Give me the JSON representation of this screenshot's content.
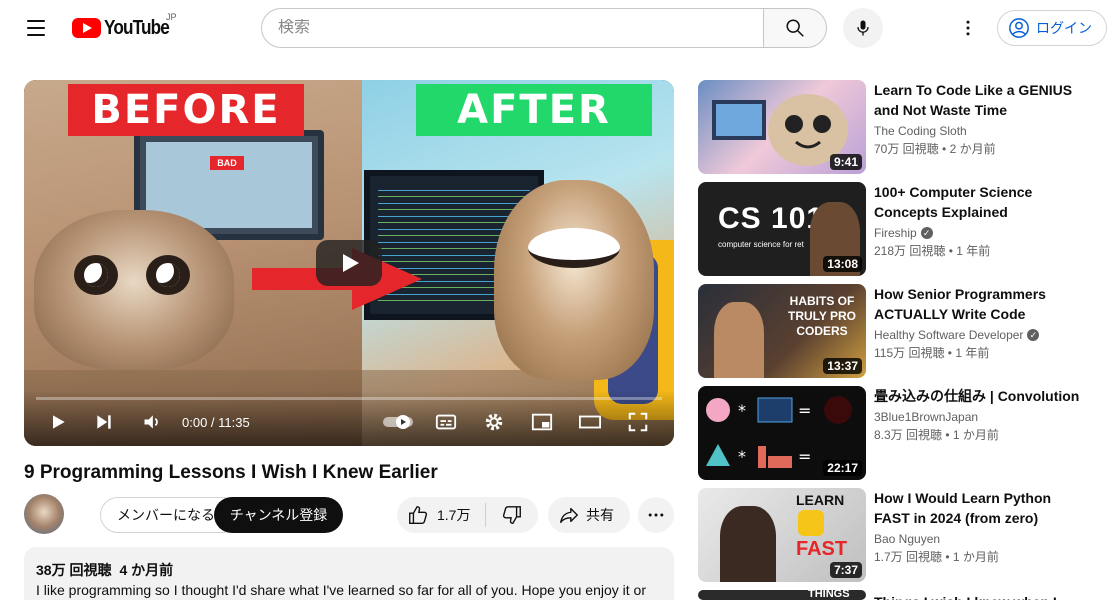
{
  "header": {
    "logo_text": "YouTube",
    "region": "JP",
    "search_placeholder": "検索",
    "signin_label": "ログイン"
  },
  "player": {
    "time_display": "0:00 / 11:35",
    "thumb_before_label": "BEFORE",
    "thumb_after_label": "AFTER",
    "thumb_bad_label": "BAD"
  },
  "video": {
    "title": "9 Programming Lessons I Wish I Knew Earlier",
    "member_label": "メンバーになる",
    "subscribe_label": "チャンネル登録",
    "like_count": "1.7万",
    "share_label": "共有",
    "views": "38万 回視聴",
    "age": "4 か月前",
    "description": "I like programming so I thought I'd share what I've learned so far for all of you. Hope you enjoy it or"
  },
  "recommendations": [
    {
      "title": "Learn To Code Like a GENIUS and Not Waste Time",
      "channel": "The Coding Sloth",
      "verified": false,
      "views": "70万 回視聴",
      "age": "2 か月前",
      "duration": "9:41"
    },
    {
      "title": "100+ Computer Science Concepts Explained",
      "channel": "Fireship",
      "verified": true,
      "views": "218万 回視聴",
      "age": "1 年前",
      "duration": "13:08",
      "thumb_text": "CS 101",
      "thumb_sub": "computer science for ret"
    },
    {
      "title": "How Senior Programmers ACTUALLY Write Code",
      "channel": "Healthy Software Developer",
      "verified": true,
      "views": "115万 回視聴",
      "age": "1 年前",
      "duration": "13:37",
      "thumb_text": "HABITS OF TRULY PRO CODERS"
    },
    {
      "title": "畳み込みの仕組み | Convolution",
      "channel": "3Blue1BrownJapan",
      "verified": false,
      "views": "8.3万 回視聴",
      "age": "1 か月前",
      "duration": "22:17"
    },
    {
      "title": "How I Would Learn Python FAST in 2024 (from zero)",
      "channel": "Bao Nguyen",
      "verified": false,
      "views": "1.7万 回視聴",
      "age": "1 か月前",
      "duration": "7:37",
      "thumb_text_1": "LEARN",
      "thumb_text_2": "FAST"
    },
    {
      "title": "Things I wish I knew when I",
      "thumb_text": "THINGS"
    }
  ],
  "colors": {
    "brand_red": "#ff0000",
    "link_blue": "#065fd4",
    "before_red": "#e5262a",
    "after_green": "#23d86a"
  }
}
